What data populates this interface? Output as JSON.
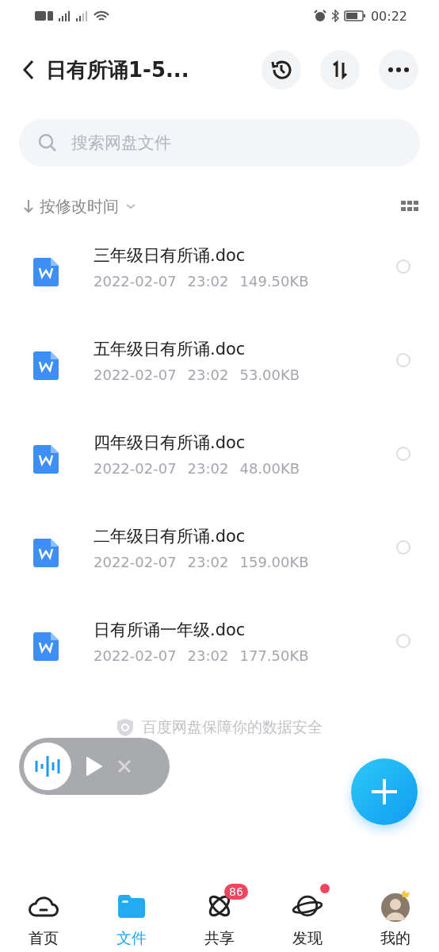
{
  "status_bar": {
    "time": "00:22"
  },
  "header": {
    "title": "日有所诵1-5..."
  },
  "search": {
    "placeholder": "搜索网盘文件"
  },
  "sort": {
    "label": "按修改时间"
  },
  "files": [
    {
      "name": "三年级日有所诵.doc",
      "date": "2022-02-07",
      "time": "23:02",
      "size": "149.50KB",
      "selected": false
    },
    {
      "name": "五年级日有所诵.doc",
      "date": "2022-02-07",
      "time": "23:02",
      "size": "53.00KB",
      "selected": false
    },
    {
      "name": "四年级日有所诵.doc",
      "date": "2022-02-07",
      "time": "23:02",
      "size": "48.00KB",
      "selected": false
    },
    {
      "name": "二年级日有所诵.doc",
      "date": "2022-02-07",
      "time": "23:02",
      "size": "159.00KB",
      "selected": false
    },
    {
      "name": "日有所诵一年级.doc",
      "date": "2022-02-07",
      "time": "23:02",
      "size": "177.50KB",
      "selected": false
    }
  ],
  "footer_note": "百度网盘保障你的数据安全",
  "nav": [
    {
      "kind": "home",
      "label": "首页",
      "selected": false
    },
    {
      "kind": "files",
      "label": "文件",
      "selected": true
    },
    {
      "kind": "share",
      "label": "共享",
      "selected": false,
      "badge": "86"
    },
    {
      "kind": "discover",
      "label": "发现",
      "selected": false,
      "dot": true
    },
    {
      "kind": "avatar",
      "label": "我的",
      "selected": false
    }
  ]
}
